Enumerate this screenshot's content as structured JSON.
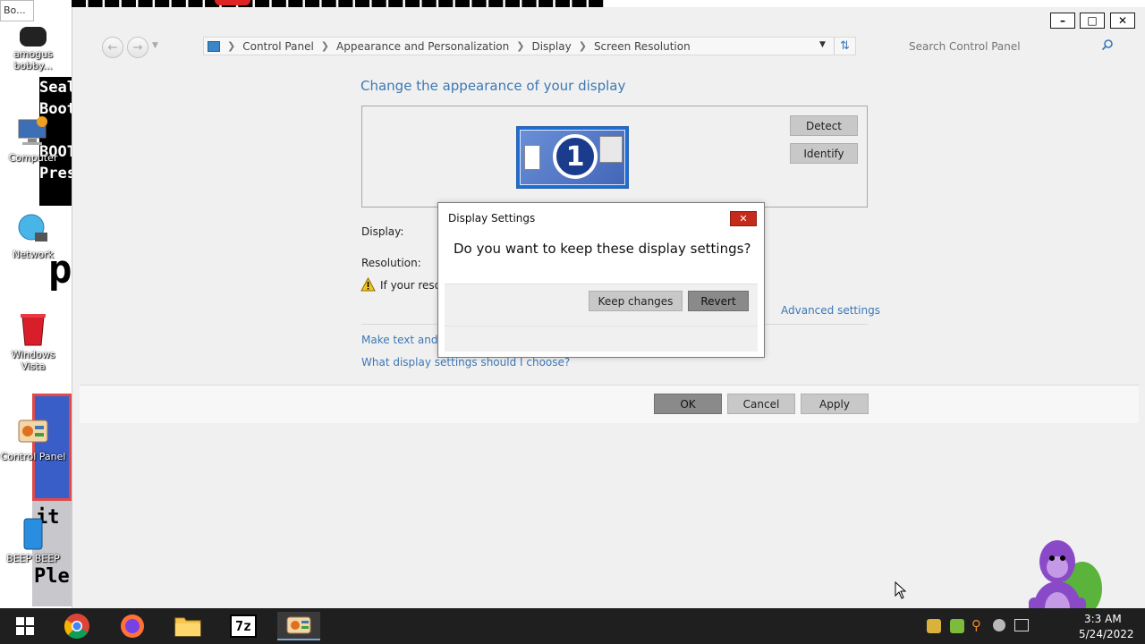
{
  "desktop": {
    "tooltip": "Bo...",
    "icons": [
      {
        "label": "amogus bobby..."
      },
      {
        "label": "Computer"
      },
      {
        "label": "Network"
      },
      {
        "label": "Windows Vista"
      },
      {
        "label": "Control Panel"
      },
      {
        "label": "BEEP BEEP"
      }
    ],
    "wallpaper_texts": [
      "Seal",
      "Boot",
      "BOOT",
      "Pres",
      "p",
      "it",
      "Ple"
    ]
  },
  "window": {
    "caption_buttons": {
      "minimize": "–",
      "maximize": "□",
      "close": "✕"
    },
    "breadcrumb": [
      "Control Panel",
      "Appearance and Personalization",
      "Display",
      "Screen Resolution"
    ],
    "search_placeholder": "Search Control Panel",
    "heading": "Change the appearance of your display",
    "monitor_number": "1",
    "detect_label": "Detect",
    "identify_label": "Identify",
    "display_label": "Display:",
    "resolution_label": "Resolution:",
    "warning_text": "If your resol",
    "advanced_link": "Advanced settings",
    "link_text_size": "Make text and ot",
    "link_help": "What display settings should I choose?",
    "ok_label": "OK",
    "cancel_label": "Cancel",
    "apply_label": "Apply"
  },
  "dialog": {
    "title": "Display Settings",
    "question": "Do you want to keep these display settings?",
    "keep_label": "Keep changes",
    "revert_label": "Revert"
  },
  "taskbar": {
    "clock_time": "3:3 AM",
    "clock_date": "5/24/2022",
    "apps": [
      "chrome-icon",
      "firefox-icon",
      "file-explorer-icon",
      "7zip-icon",
      "control-panel-icon"
    ]
  },
  "colors": {
    "link_blue": "#3c78b5",
    "taskbar": "#1f1f1f",
    "window_bg": "#f0f0f0",
    "close_red": "#c42b1c"
  }
}
